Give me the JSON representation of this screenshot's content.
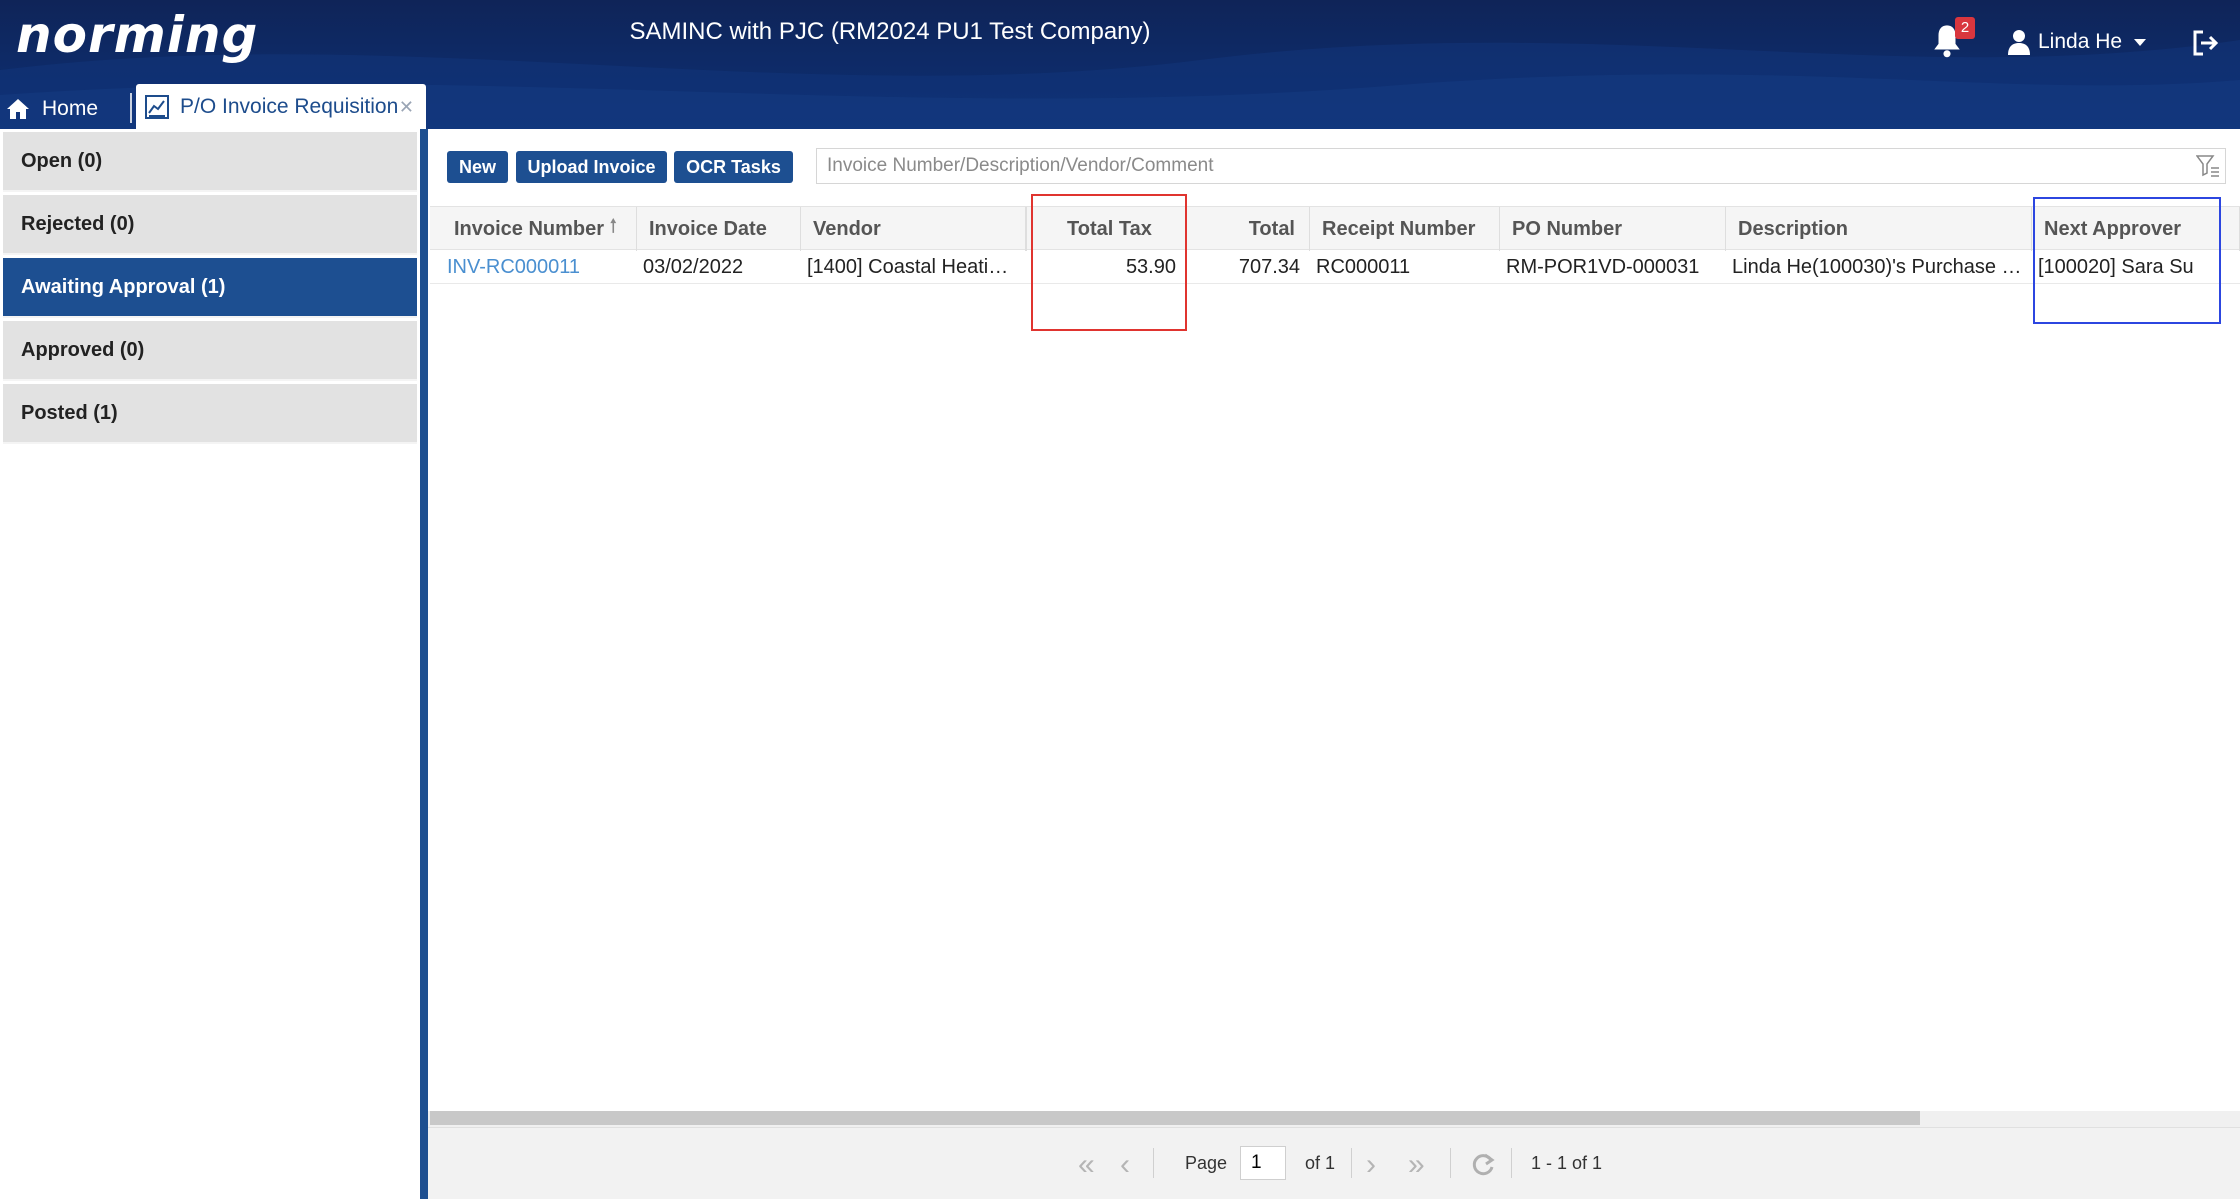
{
  "header": {
    "logo": "norming",
    "company": "SAMINC with PJC (RM2024 PU1 Test Company)",
    "notification_count": "2",
    "user_name": "Linda He"
  },
  "tabs": {
    "home": "Home",
    "active": "P/O Invoice Requisition"
  },
  "sidebar": {
    "items": [
      {
        "label": "Open (0)"
      },
      {
        "label": "Rejected (0)"
      },
      {
        "label": "Awaiting Approval (1)"
      },
      {
        "label": "Approved (0)"
      },
      {
        "label": "Posted (1)"
      }
    ],
    "active_index": 2
  },
  "toolbar": {
    "new_label": "New",
    "upload_label": "Upload Invoice",
    "ocr_label": "OCR Tasks",
    "search_placeholder": "Invoice Number/Description/Vendor/Comment"
  },
  "grid": {
    "columns": [
      "Invoice Number",
      "Invoice Date",
      "Vendor",
      "Total Tax",
      "Total",
      "Receipt Number",
      "PO Number",
      "Description",
      "Next Approver"
    ],
    "sorted_column": "Invoice Number",
    "rows": [
      {
        "invoice_number": "INV-RC000011",
        "invoice_date": "03/02/2022",
        "vendor": "[1400] Coastal Heati…",
        "total_tax": "53.90",
        "total": "707.34",
        "receipt_number": "RC000011",
        "po_number": "RM-POR1VD-000031",
        "description": "Linda He(100030)'s Purchase …",
        "next_approver": "[100020] Sara Su"
      }
    ]
  },
  "pager": {
    "page_label": "Page",
    "page_value": "1",
    "of_label": "of 1",
    "range": "1 - 1 of 1"
  },
  "colors": {
    "header_bg": "#0e2a66",
    "accent": "#1d4f91",
    "link": "#4a8fd0",
    "highlight_red": "#e0342f",
    "highlight_blue": "#2c46e0"
  }
}
